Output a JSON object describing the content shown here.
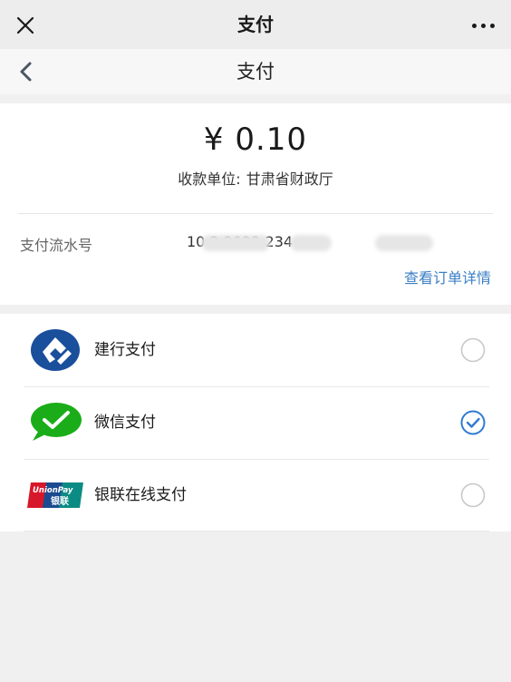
{
  "wechat_bar": {
    "title": "支付",
    "close_icon": "close-icon",
    "more_icon": "more-icon"
  },
  "page_header": {
    "title": "支付",
    "back_icon": "chevron-left-icon"
  },
  "payment": {
    "amount": "¥ 0.10",
    "payee_label": "收款单位:",
    "payee_name": "甘肃省财政厅",
    "serial_label": "支付流水号",
    "serial_value_visible": "10 2 2022 234",
    "order_details_link": "查看订单详情"
  },
  "methods": [
    {
      "label": "建行支付",
      "icon": "ccb-logo-icon",
      "selected": false
    },
    {
      "label": "微信支付",
      "icon": "wechat-pay-icon",
      "selected": true
    },
    {
      "label": "银联在线支付",
      "icon": "unionpay-logo-icon",
      "selected": false
    }
  ],
  "colors": {
    "link": "#3b7fc4",
    "radio_selected": "#2f7bd0",
    "wechat_green": "#1aad19",
    "ccb_blue": "#1a4f9c"
  }
}
